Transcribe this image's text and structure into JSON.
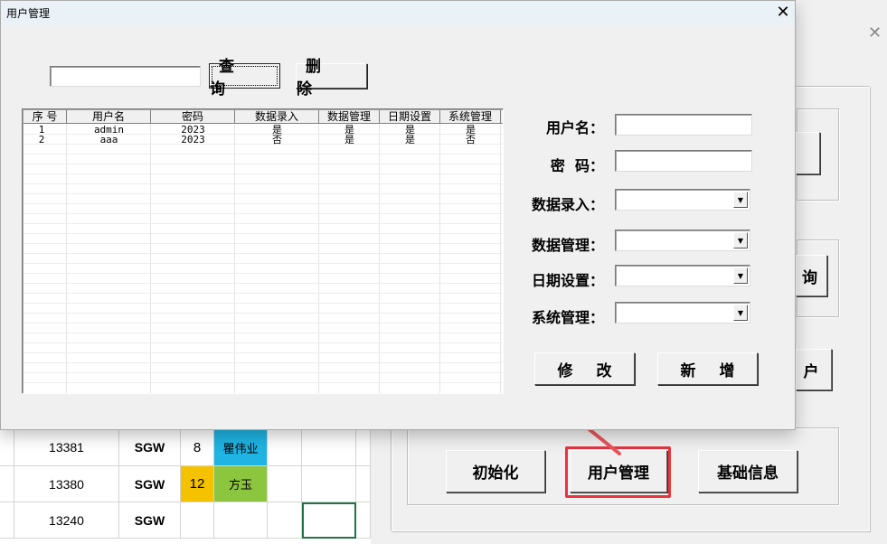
{
  "dialog": {
    "title": "用户管理",
    "close_glyph": "✕"
  },
  "search": {
    "value": "",
    "query_label": "查 询",
    "delete_label": "删 除"
  },
  "list": {
    "columns": [
      "序 号",
      "用户名",
      "密码",
      "数据录入",
      "数据管理",
      "日期设置",
      "系统管理"
    ],
    "rows": [
      [
        "1",
        "admin",
        "2023",
        "是",
        "是",
        "是",
        "是"
      ],
      [
        "2",
        "aaa",
        "2023",
        "否",
        "是",
        "是",
        "否"
      ]
    ]
  },
  "form": {
    "username_label": "用户名：",
    "password_label": "密  码：",
    "data_entry_label": "数据录入：",
    "data_mgmt_label": "数据管理：",
    "date_setting_label": "日期设置：",
    "system_mgmt_label": "系统管理：",
    "username_value": "",
    "password_value": "",
    "data_entry_value": "",
    "data_mgmt_value": "",
    "date_setting_value": "",
    "system_mgmt_value": "",
    "modify_label": "修 改",
    "add_label": "新 增"
  },
  "background_window": {
    "close_glyph": "✕",
    "partial_button_2": "询",
    "partial_button_3": "户",
    "init_label": "初始化",
    "user_mgmt_label": "用户管理",
    "basic_info_label": "基础信息"
  },
  "sheet": {
    "rows": [
      {
        "id": "13381",
        "code": "SGW",
        "num": "8",
        "name": "瞿伟业"
      },
      {
        "id": "13380",
        "code": "SGW",
        "num": "12",
        "name": "方玉"
      },
      {
        "id": "13240",
        "code": "SGW",
        "num": "",
        "name": ""
      }
    ]
  },
  "colors": {
    "highlight_box": "#e8343f",
    "arrow": "#e8545a",
    "cell_blue": "#1fb4e3",
    "cell_orange": "#f5c200",
    "cell_green": "#8cc63f",
    "titlebar": "#eaf2f7"
  }
}
